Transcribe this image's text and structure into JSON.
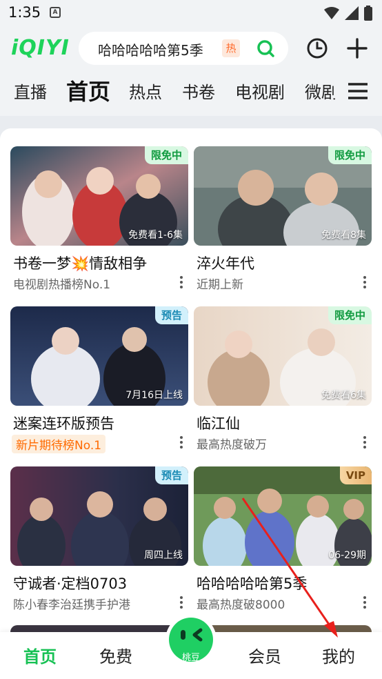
{
  "status_bar": {
    "time": "1:35",
    "notification_icon": "A"
  },
  "header": {
    "logo": "iQIYI",
    "search_text": "哈哈哈哈哈第5季",
    "hot_badge": "热"
  },
  "tabs": [
    "直播",
    "首页",
    "热点",
    "书卷",
    "电视剧",
    "微剧"
  ],
  "cards": [
    {
      "badge": "限免中",
      "badge_type": "free",
      "episode": "免费看1-6集",
      "title": "书卷一梦💥情敌相争",
      "sub": "电视剧热播榜No.1"
    },
    {
      "badge": "限免中",
      "badge_type": "free",
      "episode": "免费看8集",
      "title": "淬火年代",
      "sub": "近期上新"
    },
    {
      "badge": "预告",
      "badge_type": "preview",
      "episode": "7月16日上线",
      "title": "迷案连环版预告",
      "sub": "新片期待榜No.1"
    },
    {
      "badge": "限免中",
      "badge_type": "free",
      "episode": "免费看6集",
      "title": "临江仙",
      "sub": "最高热度破万"
    },
    {
      "badge": "预告",
      "badge_type": "preview",
      "episode": "周四上线",
      "title": "守诚者·定档0703",
      "sub": "陈小春李治廷携手护港"
    },
    {
      "badge": "VIP",
      "badge_type": "vip",
      "episode": "06-29期",
      "title": "哈哈哈哈哈第5季",
      "sub": "最高热度破8000"
    }
  ],
  "bottom_nav": {
    "home": "首页",
    "free": "免费",
    "center": "桃豆",
    "vip": "会员",
    "me": "我的"
  },
  "colors": {
    "accent": "#17c154",
    "hot": "#ff6a2b",
    "arrow": "#e8201c"
  }
}
